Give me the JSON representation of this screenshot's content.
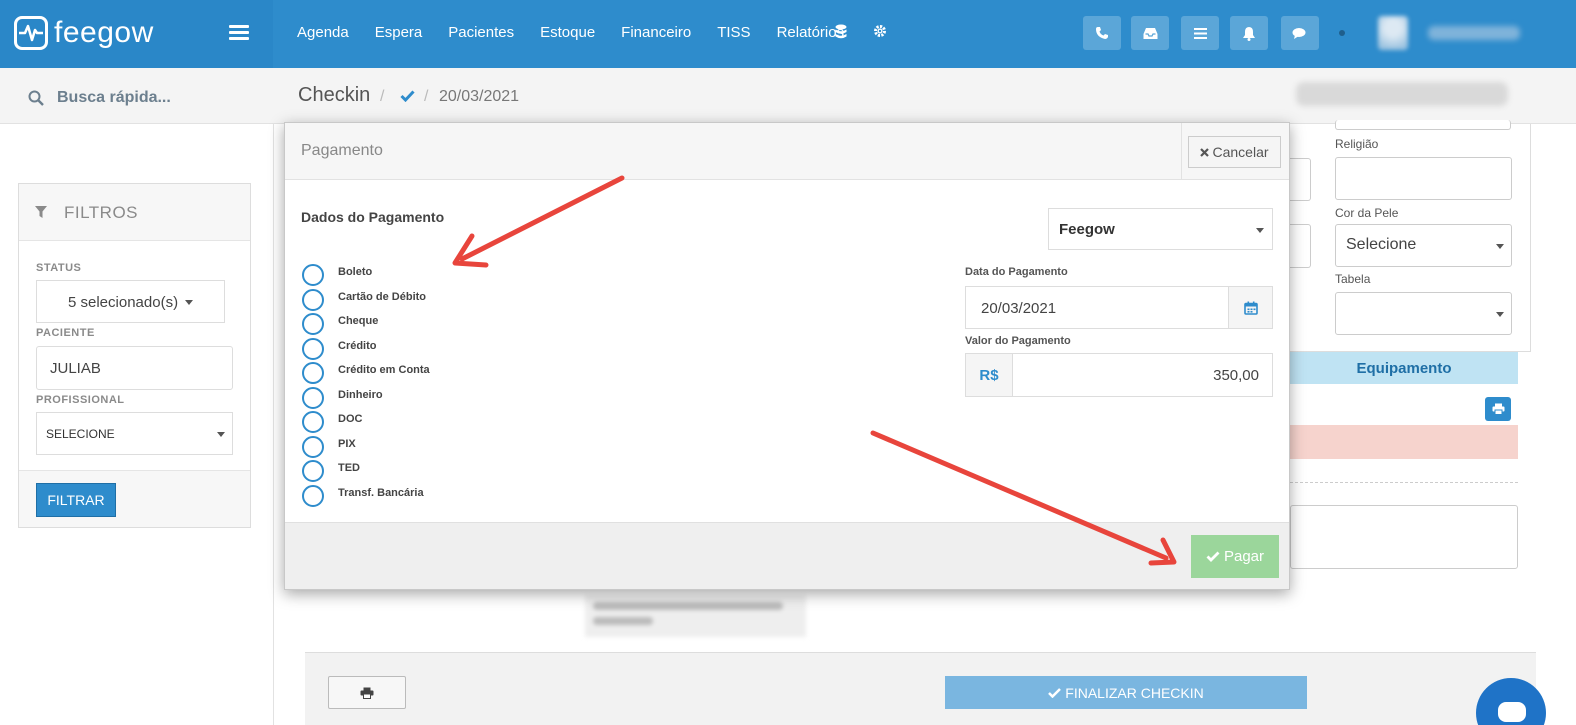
{
  "brand": {
    "name": "feegow"
  },
  "topnav": [
    "Agenda",
    "Espera",
    "Pacientes",
    "Estoque",
    "Financeiro",
    "TISS",
    "Relatórios"
  ],
  "search": {
    "placeholder": "Busca rápida..."
  },
  "filters": {
    "title": "FILTROS",
    "status_label": "STATUS",
    "status_value": "5 selecionado(s)",
    "paciente_label": "PACIENTE",
    "paciente_value": "JULIAB",
    "profissional_label": "PROFISSIONAL",
    "profissional_value": "SELECIONE",
    "submit_label": "FILTRAR"
  },
  "breadcrumb": {
    "title": "Checkin",
    "date": "20/03/2021"
  },
  "background_form": {
    "religiao_label": "Religião",
    "cor_pele_label": "Cor da Pele",
    "cor_pele_value": "Selecione",
    "tabela_label": "Tabela",
    "equipamento_label": "Equipamento",
    "finalizar_label": "FINALIZAR CHECKIN"
  },
  "modal": {
    "title": "Pagamento",
    "cancel_label": "Cancelar",
    "section_title": "Dados do Pagamento",
    "provider": "Feegow",
    "payment_methods": [
      "Boleto",
      "Cartão de Débito",
      "Cheque",
      "Crédito",
      "Crédito em Conta",
      "Dinheiro",
      "DOC",
      "PIX",
      "TED",
      "Transf. Bancária"
    ],
    "date_label": "Data do Pagamento",
    "date_value": "20/03/2021",
    "value_label": "Valor do Pagamento",
    "currency_prefix": "R$",
    "value": "350,00",
    "pay_label": "Pagar"
  },
  "colors": {
    "primary": "#2e8ccc",
    "pay_button": "#9bd69b",
    "annotation_arrow": "#e8453c"
  }
}
